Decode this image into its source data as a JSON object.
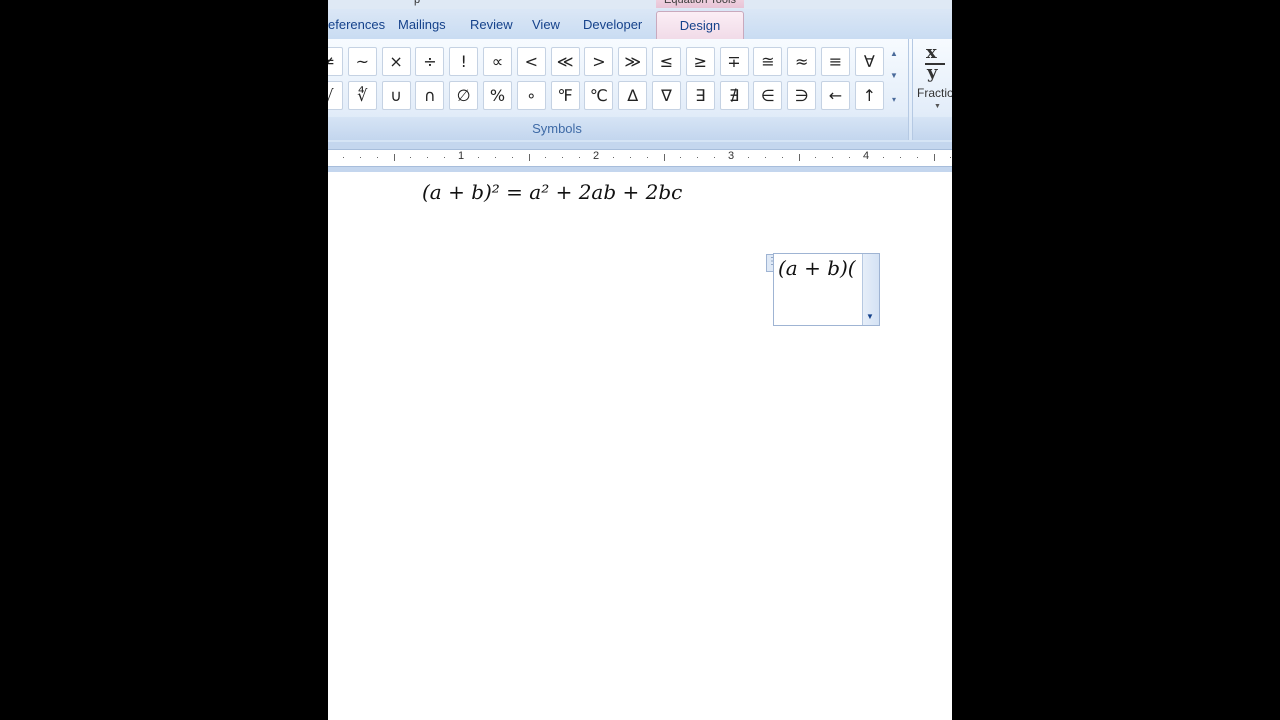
{
  "titlebar": {
    "contextual_tab_group": "Equation Tools",
    "title_fragment": "p"
  },
  "tabs": [
    {
      "id": "references",
      "label": "eferences"
    },
    {
      "id": "mailings",
      "label": "Mailings"
    },
    {
      "id": "review",
      "label": "Review"
    },
    {
      "id": "view",
      "label": "View"
    },
    {
      "id": "developer",
      "label": "Developer"
    },
    {
      "id": "design",
      "label": "Design",
      "active": true
    }
  ],
  "ribbon": {
    "symbols_group_label": "Symbols",
    "symbols_row1": [
      "≠",
      "~",
      "×",
      "÷",
      "!",
      "∝",
      "<",
      "≪",
      ">",
      "≫",
      "≤",
      "≥",
      "∓",
      "≅",
      "≈",
      "≡",
      "∀"
    ],
    "symbols_row2": [
      "√",
      "∜",
      "∪",
      "∩",
      "∅",
      "%",
      "∘",
      "℉",
      "℃",
      "∆",
      "∇",
      "∃",
      "∄",
      "∈",
      "∋",
      "←",
      "↑"
    ],
    "structures": {
      "fraction_label": "Fraction",
      "fraction_numerator": "x",
      "fraction_denominator": "y"
    }
  },
  "ruler": {
    "labels": [
      "1",
      "2",
      "3",
      "4"
    ]
  },
  "document": {
    "equation_1": "(𝑎 + 𝑏)² = 𝑎² + 2𝑎𝑏 + 2𝑏𝑐",
    "equation_2_in_progress": "(𝑎 + 𝑏)("
  },
  "colors": {
    "ribbon_text": "#15428b",
    "contextual_tab": "#f1dbe8",
    "background": "#000000"
  }
}
